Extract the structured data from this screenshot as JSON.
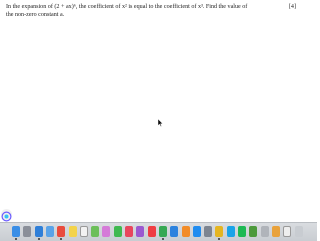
{
  "question": {
    "line1": "In the expansion of (2 + ax)⁶, the coefficient of x² is equal to the coefficient of x³.  Find the value of",
    "line2": "the non-zero constant a.",
    "marks": "[4]"
  },
  "colors": {
    "page_bg": "#ffffff",
    "dock_bg": "#d0d3d8",
    "text": "#222222"
  },
  "dock": {
    "icons": [
      {
        "name": "finder-icon",
        "color": "#3a8ee6"
      },
      {
        "name": "launchpad-icon",
        "color": "#8a8f99"
      },
      {
        "name": "safari-icon",
        "color": "#2f7fd8"
      },
      {
        "name": "mail-icon",
        "color": "#5aa3e8"
      },
      {
        "name": "calendar-icon",
        "color": "#e94b3c"
      },
      {
        "name": "notes-icon",
        "color": "#f3d34a"
      },
      {
        "name": "reminders-icon",
        "color": "#f2f2f2"
      },
      {
        "name": "maps-icon",
        "color": "#6cbf5a"
      },
      {
        "name": "photos-icon",
        "color": "#d57bd8"
      },
      {
        "name": "facetime-icon",
        "color": "#3fb950"
      },
      {
        "name": "music-icon",
        "color": "#e8465d"
      },
      {
        "name": "podcasts-icon",
        "color": "#9b59d0"
      },
      {
        "name": "news-icon",
        "color": "#ef3d43"
      },
      {
        "name": "numbers-icon",
        "color": "#36a853"
      },
      {
        "name": "keynote-icon",
        "color": "#2c82de"
      },
      {
        "name": "pages-icon",
        "color": "#f28c28"
      },
      {
        "name": "app-store-icon",
        "color": "#1f8cf0"
      },
      {
        "name": "preferences-icon",
        "color": "#7d8591"
      },
      {
        "name": "chrome-icon",
        "color": "#e5b521"
      },
      {
        "name": "skype-icon",
        "color": "#1aa3e8"
      },
      {
        "name": "spotify-icon",
        "color": "#1db954"
      },
      {
        "name": "torrent-icon",
        "color": "#4d9a3c"
      },
      {
        "name": "script-icon",
        "color": "#b0b4ba"
      },
      {
        "name": "pencil-icon",
        "color": "#e9a23b"
      },
      {
        "name": "document-icon",
        "color": "#eeeeee"
      },
      {
        "name": "trash-icon",
        "color": "#c8ccd1"
      }
    ]
  }
}
